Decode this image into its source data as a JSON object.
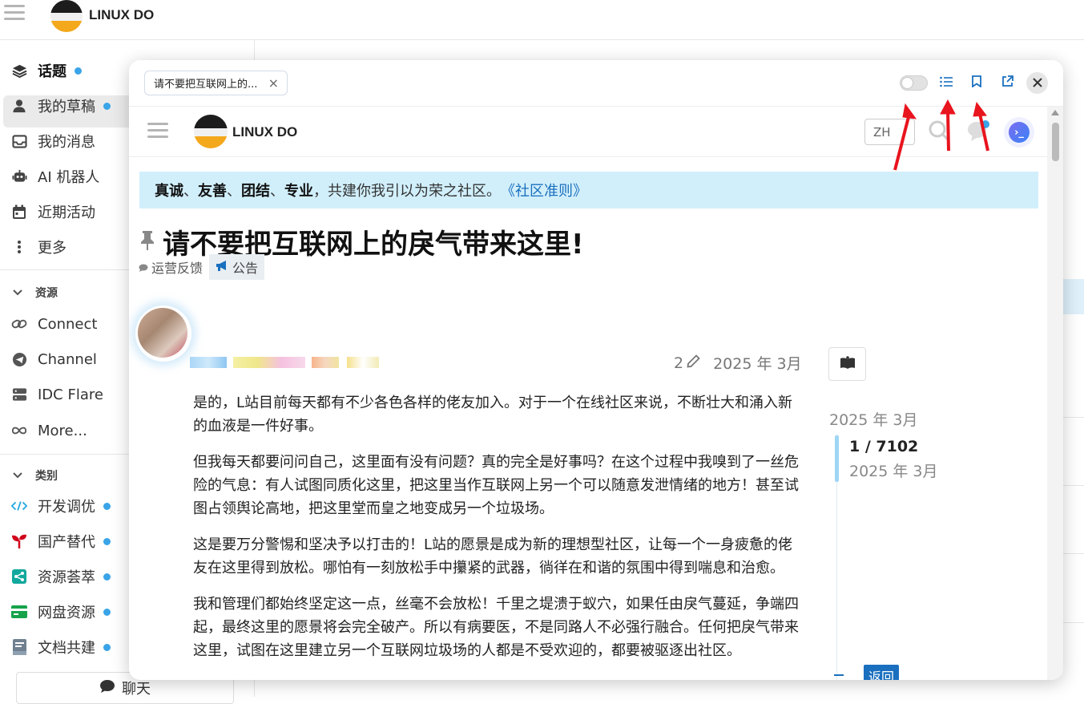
{
  "site": {
    "name": "LINUX DO"
  },
  "sidebar": {
    "items": [
      {
        "label": "话题",
        "icon": "layers-icon",
        "dot": true
      },
      {
        "label": "我的草稿",
        "icon": "user-icon",
        "dot": true
      },
      {
        "label": "我的消息",
        "icon": "inbox-icon",
        "dot": false
      },
      {
        "label": "AI 机器人",
        "icon": "robot-icon",
        "dot": false
      },
      {
        "label": "近期活动",
        "icon": "calendar-icon",
        "dot": false
      },
      {
        "label": "更多",
        "icon": "more-vertical-icon",
        "dot": false
      }
    ],
    "resources_title": "资源",
    "resources": [
      {
        "label": "Connect",
        "icon": "link-icon"
      },
      {
        "label": "Channel",
        "icon": "telegram-icon"
      },
      {
        "label": "IDC Flare",
        "icon": "server-icon"
      },
      {
        "label": "More...",
        "icon": "infinity-icon"
      }
    ],
    "categories_title": "类别",
    "categories": [
      {
        "label": "开发调优",
        "icon": "code-icon",
        "color": "#25aae1"
      },
      {
        "label": "国产替代",
        "icon": "sprout-icon",
        "color": "#d0021b"
      },
      {
        "label": "资源荟萃",
        "icon": "share-icon",
        "color": "#12a89d"
      },
      {
        "label": "网盘资源",
        "icon": "card-icon",
        "color": "#16a34a"
      },
      {
        "label": "文档共建",
        "icon": "book-icon",
        "color": "#708090"
      }
    ],
    "chat_label": "聊天"
  },
  "popup": {
    "tab_title": "请不要把互联网上的...",
    "inner": {
      "lang_button": "ZH",
      "banner": {
        "words": [
          "真诚",
          "友善",
          "团结",
          "专业"
        ],
        "sep": "、",
        "rest": "，共建你我引以为荣之社区。",
        "link": "《社区准则》"
      },
      "topic": {
        "title": "请不要把互联网上的戾气带来这里!",
        "category": "运营反馈",
        "tag": "公告"
      },
      "post": {
        "edits": "2",
        "date": "2025 年 3月",
        "paragraphs": [
          "是的，L站目前每天都有不少各色各样的佬友加入。对于一个在线社区来说，不断壮大和涌入新的血液是一件好事。",
          "但我每天都要问问自己，这里面有没有问题？真的完全是好事吗？在这个过程中我嗅到了一丝危险的气息：有人试图同质化这里，把这里当作互联网上另一个可以随意发泄情绪的地方！甚至试图占领舆论高地，把这里堂而皇之地变成另一个垃圾场。",
          "这是要万分警惕和坚决予以打击的！L站的愿景是成为新的理想型社区，让每一个一身疲惫的佬友在这里得到放松。哪怕有一刻放松手中攥紧的武器，徜徉在和谐的氛围中得到喘息和治愈。",
          "我和管理们都始终坚定这一点，丝毫不会放松！千里之堤溃于蚁穴，如果任由戾气蔓延，争端四起，最终这里的愿景将会完全破产。所以有病要医，不是同路人不必强行融合。任何把戾气带来这里，试图在这里建立另一个互联网垃圾场的人都是不受欢迎的，都要被驱逐出社区。"
        ]
      },
      "timeline": {
        "top_date": "2025 年 3月",
        "count": "1 / 7102",
        "date": "2025 年 3月",
        "back_label": "返回"
      }
    }
  },
  "colors": {
    "accent": "#1a6fbf",
    "banner_bg": "#d1effb",
    "dot": "#3aa4e8",
    "arrow": "#e8141e"
  }
}
